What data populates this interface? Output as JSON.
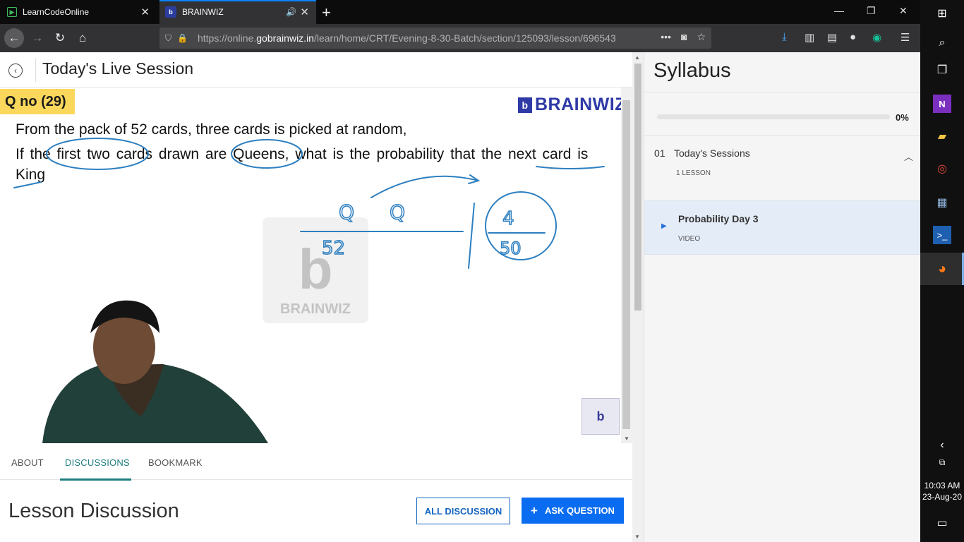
{
  "browser": {
    "tabs": [
      {
        "title": "LearnCodeOnline",
        "active": false
      },
      {
        "title": "BRAINWIZ",
        "active": true
      }
    ],
    "url_prefix": "https://online.",
    "url_domain": "gobrainwiz.in",
    "url_path": "/learn/home/CRT/Evening-8-30-Batch/section/125093/lesson/696543"
  },
  "page": {
    "title": "Today's Live Session"
  },
  "video": {
    "question_number": "Q no (29)",
    "brand": "BRAINWIZ",
    "question_line1": "From the pack of 52 cards, three cards is picked at random,",
    "question_line2": "If the first two cards drawn are Queens, what is the probability that the next card is",
    "question_line3": "King",
    "watermark": "BRAINWIZ"
  },
  "tabs": {
    "about": "ABOUT",
    "discussions": "DISCUSSIONS",
    "bookmark": "BOOKMARK",
    "active": "discussions"
  },
  "discussion": {
    "title": "Lesson Discussion",
    "all_button": "ALL DISCUSSION",
    "ask_button": "ASK QUESTION"
  },
  "syllabus": {
    "title": "Syllabus",
    "progress_percent": 0,
    "progress_label": "0%",
    "sections": [
      {
        "number": "01",
        "name": "Today's Sessions",
        "lesson_count": "1 LESSON",
        "lessons": [
          {
            "name": "Probability Day 3",
            "type": "VIDEO"
          }
        ]
      }
    ]
  },
  "taskbar": {
    "time": "10:03 AM",
    "date": "23-Aug-20"
  },
  "colors": {
    "accent_teal": "#1e7e7e",
    "primary_blue": "#0a6cf0",
    "brand_blue": "#2e3aa6",
    "highlight_yellow": "#fbd75b",
    "ink_blue": "#2d7fc0"
  }
}
